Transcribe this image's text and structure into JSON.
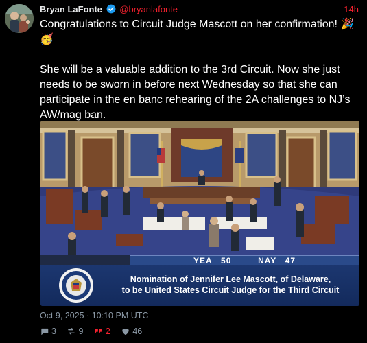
{
  "author": {
    "name": "Bryan LaFonte",
    "handle": "@bryanlafonte",
    "verified_icon": "verified-badge-icon",
    "age": "14h"
  },
  "post": {
    "line1": "Congratulations to Circuit Judge Mascott on her confirmation! 🎉🥳",
    "line2": "She will be a valuable addition to the 3rd Circuit. Now she just needs to be sworn in before next Wednesday so that she can participate in the en banc rehearing of the 2A challenges to NJ’s AW/mag ban."
  },
  "media": {
    "vote": {
      "yea_label": "YEA",
      "yea_count": "50",
      "nay_label": "NAY",
      "nay_count": "47"
    },
    "caption_line1": "Nomination of Jennifer Lee Mascott, of Delaware,",
    "caption_line2": "to be United States Circuit Judge for the Third Circuit",
    "seal_icon": "us-senate-seal-icon"
  },
  "timestamp": "Oct 9, 2025 · 10:10 PM UTC",
  "stats": {
    "replies": "3",
    "reposts": "9",
    "quotes": "2",
    "likes": "46"
  },
  "colors": {
    "background": "#000000",
    "text": "#ffffff",
    "muted": "#8b98a5",
    "accent": "#f4212e",
    "verified": "#1d9bf0",
    "caption_blue": "#1c3770"
  }
}
